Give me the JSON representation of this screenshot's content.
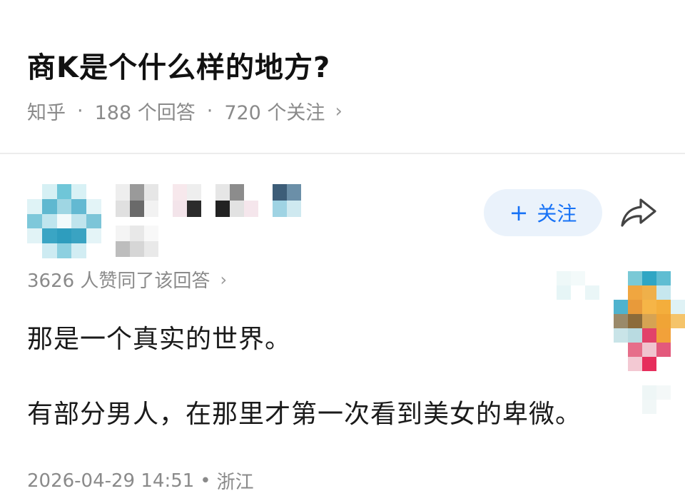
{
  "question": {
    "title": "商K是个什么样的地方?",
    "source": "知乎",
    "separator": "·",
    "answers": "188 个回答",
    "followers": "720 个关注",
    "chevron": "›"
  },
  "author": {
    "follow_label": "关注",
    "follow_icon": "+",
    "share_icon": "share-icon"
  },
  "answer": {
    "votes_text": "3626 人赞同了该回答",
    "votes_chevron": "›",
    "paragraphs": [
      "那是一个真实的世界。",
      "有部分男人，在那里才第一次看到美女的卑微。"
    ],
    "time": "2026-04-29 14:51",
    "separator": "•",
    "location": "浙江"
  },
  "colors": {
    "accent": "#1772f6",
    "follow_bg": "#eaf2fb",
    "meta_text": "#8a8a8a"
  }
}
